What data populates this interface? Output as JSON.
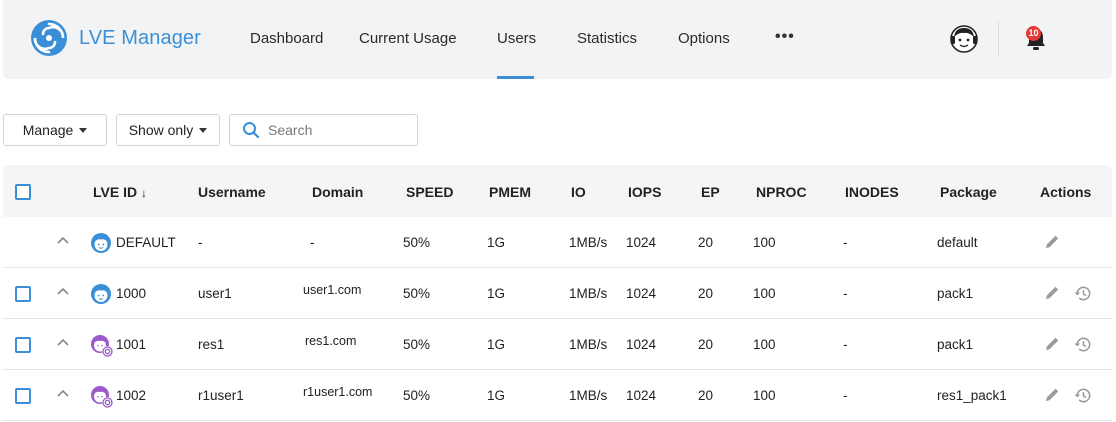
{
  "header": {
    "app_title": "LVE Manager",
    "nav": [
      "Dashboard",
      "Current Usage",
      "Users",
      "Statistics",
      "Options"
    ],
    "active_nav": "Users",
    "more_label": "•••",
    "notification_count": "10"
  },
  "toolbar": {
    "manage_label": "Manage",
    "show_only_label": "Show only",
    "search_placeholder": "Search",
    "search_value": ""
  },
  "table": {
    "columns": [
      "LVE ID",
      "Username",
      "Domain",
      "SPEED",
      "PMEM",
      "IO",
      "IOPS",
      "EP",
      "NPROC",
      "INODES",
      "Package",
      "Actions"
    ],
    "sort_indicator": "↓",
    "rows": [
      {
        "id": "DEFAULT",
        "username": "-",
        "domain": "-",
        "speed": "50%",
        "pmem": "1G",
        "io": "1MB/s",
        "iops": "1024",
        "ep": "20",
        "nproc": "100",
        "inodes": "-",
        "package": "default",
        "avatar": "user-avatar-icon",
        "has_checkbox": false,
        "has_history": false
      },
      {
        "id": "1000",
        "username": "user1",
        "domain": "user1.com",
        "speed": "50%",
        "pmem": "1G",
        "io": "1MB/s",
        "iops": "1024",
        "ep": "20",
        "nproc": "100",
        "inodes": "-",
        "package": "pack1",
        "avatar": "user-avatar-icon",
        "has_checkbox": true,
        "has_history": true
      },
      {
        "id": "1001",
        "username": "res1",
        "domain": "res1.com",
        "speed": "50%",
        "pmem": "1G",
        "io": "1MB/s",
        "iops": "1024",
        "ep": "20",
        "nproc": "100",
        "inodes": "-",
        "package": "pack1",
        "avatar": "reseller-avatar-icon",
        "has_checkbox": true,
        "has_history": true
      },
      {
        "id": "1002",
        "username": "r1user1",
        "domain": "r1user1.com",
        "speed": "50%",
        "pmem": "1G",
        "io": "1MB/s",
        "iops": "1024",
        "ep": "20",
        "nproc": "100",
        "inodes": "-",
        "package": "res1_pack1",
        "avatar": "reseller-avatar-icon",
        "has_checkbox": true,
        "has_history": true
      }
    ]
  },
  "colors": {
    "accent": "#3b8fd6",
    "reseller_accent": "#9b59c9",
    "badge": "#e53935",
    "header_bg": "#f2f3f5"
  }
}
